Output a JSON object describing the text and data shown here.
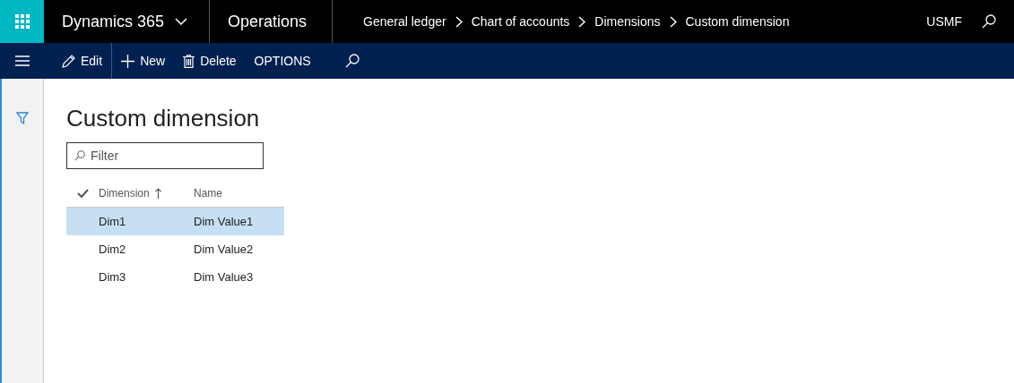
{
  "top_bar": {
    "app_name": "Dynamics 365",
    "module": "Operations",
    "breadcrumb": [
      "General ledger",
      "Chart of accounts",
      "Dimensions",
      "Custom dimension"
    ],
    "company": "USMF"
  },
  "action_bar": {
    "buttons": [
      {
        "kind": "edit",
        "label": "Edit"
      },
      {
        "kind": "new",
        "label": "New"
      },
      {
        "kind": "delete",
        "label": "Delete"
      },
      {
        "kind": "text",
        "label": "OPTIONS"
      }
    ]
  },
  "page": {
    "title": "Custom dimension",
    "filter": {
      "placeholder": "Filter"
    },
    "table": {
      "columns": [
        {
          "label": "Dimension",
          "sorted": true
        },
        {
          "label": "Name",
          "sorted": false
        }
      ],
      "rows": [
        {
          "cells": [
            "Dim1",
            "Dim Value1"
          ],
          "selected": true
        },
        {
          "cells": [
            "Dim2",
            "Dim Value2"
          ],
          "selected": false
        },
        {
          "cells": [
            "Dim3",
            "Dim Value3"
          ],
          "selected": false
        }
      ]
    }
  }
}
